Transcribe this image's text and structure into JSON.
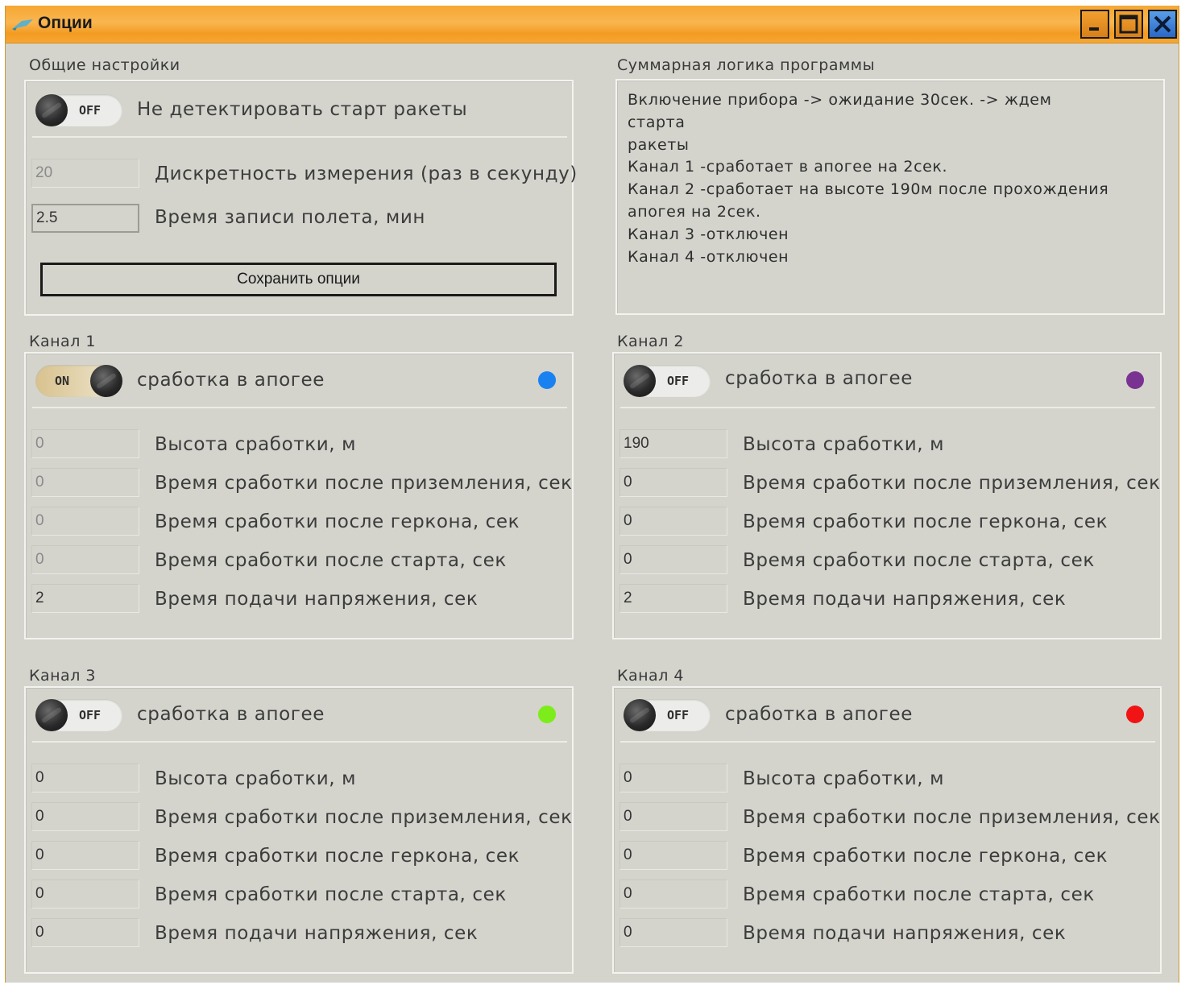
{
  "window": {
    "title": "Опции",
    "minimize_glyph": "_",
    "maximize_glyph": "□",
    "close_glyph": "✕"
  },
  "general": {
    "label": "Общие настройки",
    "detect_toggle": {
      "state_label": "OFF",
      "on": false,
      "text": "Не детектировать старт ракеты"
    },
    "sample_rate": {
      "value": "20",
      "label": "Дискретность измерения (раз в секунду)"
    },
    "record_time": {
      "value": "2.5",
      "label": "Время записи полета, мин"
    },
    "save_label": "Сохранить опции"
  },
  "summary": {
    "label": "Суммарная логика программы",
    "lines": [
      "Включение прибора -> ожидание 30сек. -> ждем старта",
      "ракеты",
      "Канал 1 -сработает в апогее на 2сек.",
      "Канал 2 -сработает на высоте 190м после прохождения",
      "апогея на 2сек.",
      "Канал 3 -отключен",
      "Канал 4 -отключен"
    ]
  },
  "channels": [
    {
      "label": "Канал 1",
      "toggle_label": "ON",
      "on": true,
      "toggle_text": "сработка в апогее",
      "color": "#1a82f0",
      "fields": [
        {
          "value": "0",
          "label": "Высота сработки, м"
        },
        {
          "value": "0",
          "label": "Время сработки после приземления, сек"
        },
        {
          "value": "0",
          "label": "Время сработки после геркона, сек"
        },
        {
          "value": "0",
          "label": "Время сработки после старта, сек"
        },
        {
          "value": "2",
          "label": "Время подачи напряжения, сек"
        }
      ]
    },
    {
      "label": "Канал 2",
      "toggle_label": "OFF",
      "on": false,
      "toggle_text": "сработка в апогее",
      "color": "#7a3292",
      "fields": [
        {
          "value": "190",
          "label": "Высота сработки, м"
        },
        {
          "value": "0",
          "label": "Время сработки после приземления, сек"
        },
        {
          "value": "0",
          "label": "Время сработки после геркона, сек"
        },
        {
          "value": "0",
          "label": "Время сработки после старта, сек"
        },
        {
          "value": "2",
          "label": "Время подачи напряжения, сек"
        }
      ]
    },
    {
      "label": "Канал 3",
      "toggle_label": "OFF",
      "on": false,
      "toggle_text": "сработка в апогее",
      "color": "#7ced1a",
      "fields": [
        {
          "value": "0",
          "label": "Высота сработки, м"
        },
        {
          "value": "0",
          "label": "Время сработки после приземления, сек"
        },
        {
          "value": "0",
          "label": "Время сработки после геркона, сек"
        },
        {
          "value": "0",
          "label": "Время сработки после старта, сек"
        },
        {
          "value": "0",
          "label": "Время подачи напряжения, сек"
        }
      ]
    },
    {
      "label": "Канал 4",
      "toggle_label": "OFF",
      "on": false,
      "toggle_text": "сработка в апогее",
      "color": "#f01414",
      "fields": [
        {
          "value": "0",
          "label": "Высота сработки, м"
        },
        {
          "value": "0",
          "label": "Время сработки после приземления, сек"
        },
        {
          "value": "0",
          "label": "Время сработки после геркона, сек"
        },
        {
          "value": "0",
          "label": "Время сработки после старта, сек"
        },
        {
          "value": "0",
          "label": "Время подачи напряжения, сек"
        }
      ]
    }
  ]
}
